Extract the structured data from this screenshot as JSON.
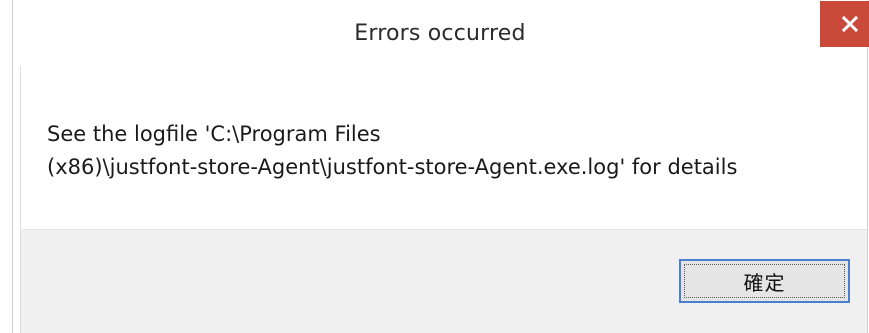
{
  "window": {
    "title": "Errors occurred"
  },
  "message": {
    "line1": "See the logfile 'C:\\Program Files",
    "line2": "(x86)\\justfont-store-Agent\\justfont-store-Agent.exe.log' for details"
  },
  "buttons": {
    "ok_label": "確定"
  },
  "icons": {
    "close": "close-icon"
  },
  "colors": {
    "close_button_bg": "#c94a3a",
    "focus_border": "#4a7fd0",
    "footer_bg": "#f0f0f0"
  }
}
